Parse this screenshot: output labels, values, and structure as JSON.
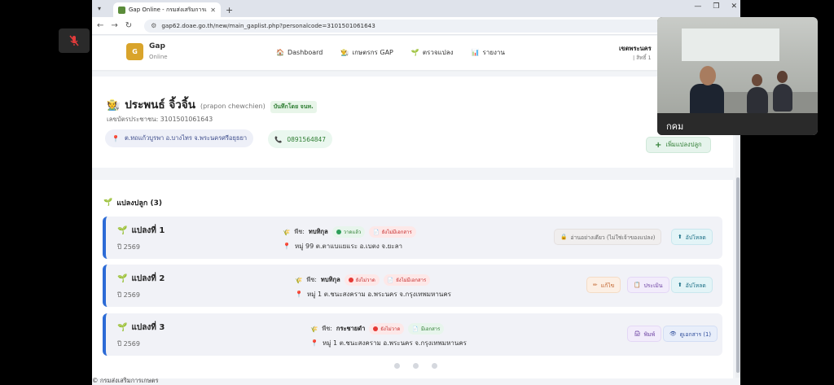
{
  "browser": {
    "tab_title": "Gap Online - กรมส่งเสริมการเกษ",
    "url": "gap62.doae.go.th/new/main_gaplist.php?personalcode=3101501061643"
  },
  "header": {
    "logo_letter": "G",
    "logo_name": "Gap",
    "logo_sub": "Online",
    "menu": [
      {
        "icon": "dashboard-icon",
        "label": "Dashboard"
      },
      {
        "icon": "farmer-icon",
        "label": "เกษตรกร GAP"
      },
      {
        "icon": "sprout-icon",
        "label": "ตรวจแปลง"
      },
      {
        "icon": "chart-icon",
        "label": "รายงาน"
      }
    ],
    "user_name": "เขตพระนคร",
    "user_sub": "| สิทธิ์ 1"
  },
  "profile": {
    "name": "ประพนธ์ จิ้วจิ้น",
    "name_en": "(prapon chewchien)",
    "recorder": "บันทึกโดย จนท.",
    "id_label": "เลขบัตรประชาชน:",
    "id_value": "3101501061643",
    "location": "ต.ทถแก้วบูรพา อ.บางไทร จ.พระนครศรีอยุธยา",
    "phone": "0891564847",
    "add_button": "เพิ่มแปลงปลูก"
  },
  "plots_section": {
    "title": "แปลงปลูก (3)"
  },
  "plots": [
    {
      "name": "แปลงที่ 1",
      "year": "ปี 2569",
      "crop_label": "พืช:",
      "crop": "ทบทิกุล",
      "status1": "วาดแล้ว",
      "status1_color": "#2e7d32",
      "status2": "ยังไม่มีเอกสาร",
      "address": "หมู่ 99 ต.ตาแบแยแระ อ.เบตง จ.ยะลา",
      "actions": [
        "อ่านอย่างเดียว (ไม่ใช่เจ้าของแปลง)",
        "อัปโหลด"
      ]
    },
    {
      "name": "แปลงที่ 2",
      "year": "ปี 2569",
      "crop_label": "พืช:",
      "crop": "ทบทิกุล",
      "status1": "ยังไม่วาด",
      "status1_color": "#c62828",
      "status2": "ยังไม่มีเอกสาร",
      "address": "หมู่ 1 ต.ชนะสงคราม อ.พระนคร จ.กรุงเทพมหานคร",
      "actions": [
        "แก้ไข",
        "ประเมิน",
        "อัปโหลด"
      ]
    },
    {
      "name": "แปลงที่ 3",
      "year": "ปี 2569",
      "crop_label": "พืช:",
      "crop": "กระชายดำ",
      "status1": "ยังไม่วาด",
      "status1_color": "#c62828",
      "status2": "มีเอกสาร",
      "address": "หมู่ 1 ต.ชนะสงคราม อ.พระนคร จ.กรุงเทพมหานคร",
      "actions": [
        "พิมพ์",
        "ดูเอกสาร (1)"
      ]
    }
  ],
  "footer": {
    "text": "© กรมส่งเสริมการเกษตร"
  },
  "video": {
    "participant_name": "กคม"
  }
}
